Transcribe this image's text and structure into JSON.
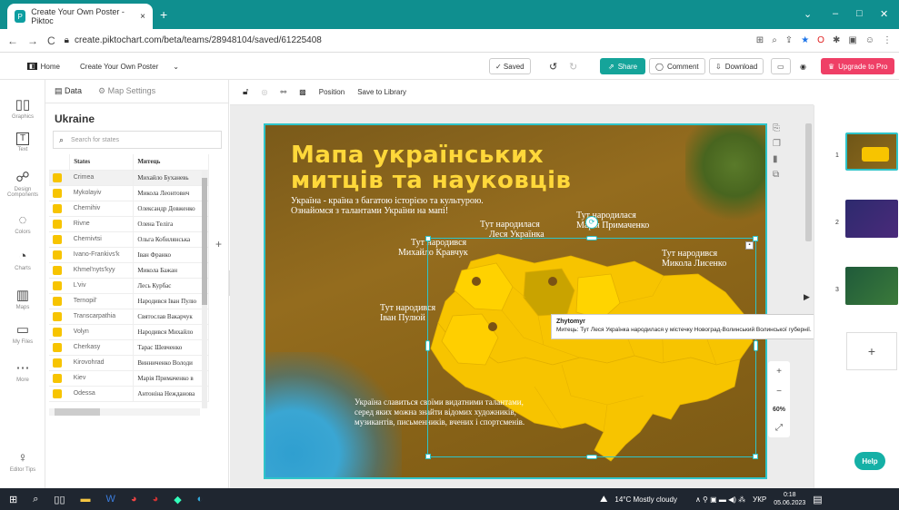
{
  "browser": {
    "tab_title": "Create Your Own Poster - Piktoc",
    "tab_close": "×",
    "new_tab": "+",
    "url": "create.piktochart.com/beta/teams/28948104/saved/61225408",
    "win_min": "–",
    "win_max": "□",
    "win_close": "✕"
  },
  "header": {
    "home": "Home",
    "doc_title": "Create Your Own Poster",
    "saved": "✓ Saved",
    "share": "Share",
    "comment": "Comment",
    "download": "Download",
    "upgrade": "Upgrade to Pro"
  },
  "leftnav": [
    {
      "label": "Graphics",
      "icon": "▯▯"
    },
    {
      "label": "Text",
      "icon": "T"
    },
    {
      "label": "Design Components",
      "icon": "☍"
    },
    {
      "label": "Colors",
      "icon": "◌"
    },
    {
      "label": "Charts",
      "icon": "◔"
    },
    {
      "label": "Maps",
      "icon": "▥"
    },
    {
      "label": "My Files",
      "icon": "▭"
    },
    {
      "label": "More",
      "icon": "⋯"
    },
    {
      "label": "Editor Tips",
      "icon": "♀"
    }
  ],
  "panel": {
    "tab_data": "Data",
    "tab_settings": "Map Settings",
    "title": "Ukraine",
    "search_placeholder": "Search for states",
    "col_states": "States",
    "col_artist": "Митець",
    "add_column": "+",
    "collapse_arrow": "◀",
    "rows": [
      {
        "state": "Crimea",
        "artist": "Михайло Буханевь"
      },
      {
        "state": "Mykolayiv",
        "artist": "Микола Леонтович"
      },
      {
        "state": "Chernihiv",
        "artist": "Олександр Довженко"
      },
      {
        "state": "Rivne",
        "artist": "Олена Теліга"
      },
      {
        "state": "Chernivtsi",
        "artist": "Ольга Кобилянська"
      },
      {
        "state": "Ivano-Frankivs'k",
        "artist": "Іван Франко"
      },
      {
        "state": "Khmel'nyts'kyy",
        "artist": "Микола Бажан"
      },
      {
        "state": "L'viv",
        "artist": "Лесь Курбас"
      },
      {
        "state": "Ternopil'",
        "artist": "Народився Іван Пулю"
      },
      {
        "state": "Transcarpathia",
        "artist": "Святослав Вакарчук"
      },
      {
        "state": "Volyn",
        "artist": "Народився Михайло"
      },
      {
        "state": "Cherkasy",
        "artist": "Тарас Шевченко"
      },
      {
        "state": "Kirovohrad",
        "artist": "Винниченко Володи"
      },
      {
        "state": "Kiev",
        "artist": "Марія Примаченко в"
      },
      {
        "state": "Odessa",
        "artist": "Антоніна Неждановa"
      }
    ]
  },
  "toolbar": {
    "position": "Position",
    "save_library": "Save to Library"
  },
  "poster": {
    "title_line1": "Мапа українських",
    "title_line2": "митців та науковців",
    "intro_line1": "Україна - країна з багатою історією та культурою.",
    "intro_line2": "Ознайомся з талантами України на мапі!",
    "label_kravchuk_1": "Тут народився",
    "label_kravchuk_2": "Михайло Кравчук",
    "label_lesya_1": "Тут народилася",
    "label_lesya_2": "Леся Українка",
    "label_prym_1": "Тут народилася",
    "label_prym_2": "Марія Примаченко",
    "label_lysenko_1": "Тут народився",
    "label_lysenko_2": "Микола Лисенко",
    "label_puliuy_1": "Тут народився",
    "label_puliuy_2": "Іван Пулюй",
    "footer_line1": "Україна славиться своїми видатними талантами,",
    "footer_line2": "серед яких можна знайти відомих художників,",
    "footer_line3": "музикантів, письменників, вчених і спортсменів.",
    "map_color": "#f7c400",
    "accent_border": "#2ec4c9"
  },
  "tooltip": {
    "region": "Zhytomyr",
    "text": "Митець: Тут Леся Українка народилася у містечку Новоград-Волинський Волинської губернії."
  },
  "zoom": {
    "plus": "+",
    "minus": "−",
    "level": "60%",
    "expand": "⤢"
  },
  "pages": {
    "numbers": [
      "1",
      "2",
      "3"
    ],
    "add": "+",
    "arrow": "▶"
  },
  "help": "Help",
  "taskbar": {
    "weather": "14°C  Mostly cloudy",
    "lang": "УКР",
    "time": "0:18",
    "date": "05.06.2023"
  }
}
